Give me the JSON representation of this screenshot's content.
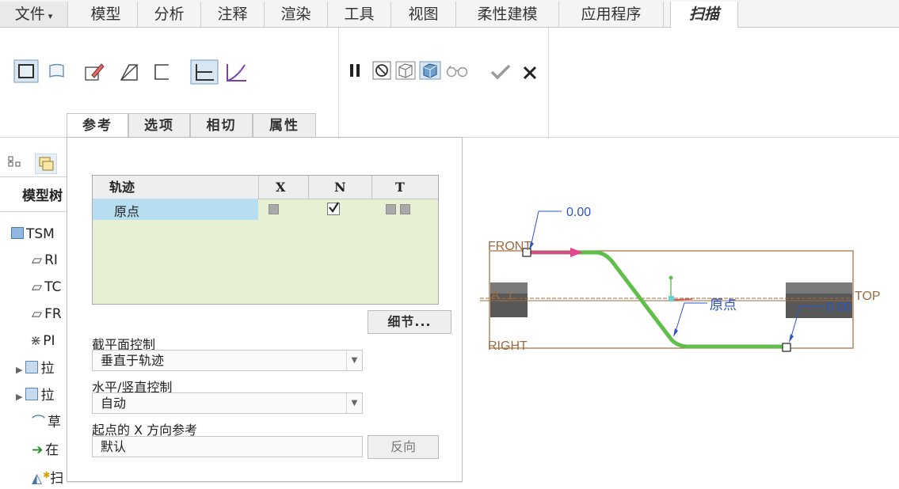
{
  "menu": {
    "file": "文件",
    "tabs": [
      "模型",
      "分析",
      "注释",
      "渲染",
      "工具",
      "视图",
      "柔性建模",
      "应用程序"
    ],
    "active_tab": "扫描"
  },
  "ribbon": {
    "subtabs": [
      "参考",
      "选项",
      "相切",
      "属性"
    ],
    "active_subtab": "参考"
  },
  "tree": {
    "header": "模型树",
    "items": [
      "TSM",
      "RI",
      "TC",
      "FR",
      "PI",
      "拉",
      "拉",
      "草",
      "在",
      "扫"
    ]
  },
  "ref": {
    "table": {
      "col_traj": "轨迹",
      "col_x": "X",
      "col_n": "N",
      "col_t": "T",
      "row_name": "原点"
    },
    "details_button": "细节...",
    "section_label": "截平面控制",
    "section_value": "垂直于轨迹",
    "hv_label": "水平/竖直控制",
    "hv_value": "自动",
    "start_label": "起点的 X 方向参考",
    "start_value": "默认",
    "flip_button": "反向"
  },
  "viewport": {
    "dim_top": "0.00",
    "dim_right": "0.00",
    "front": "FRONT",
    "top": "TOP",
    "right": "RIGHT",
    "axis": "A_1",
    "origin": "原点"
  },
  "colors": {
    "accent_green": "#5fbf4a",
    "arrow_magenta": "#e0468e",
    "row_select": "#b7def0",
    "table_bg": "#e7f0d2",
    "datum_brown": "#9c6b3f",
    "dim_blue": "#2a55c9"
  }
}
